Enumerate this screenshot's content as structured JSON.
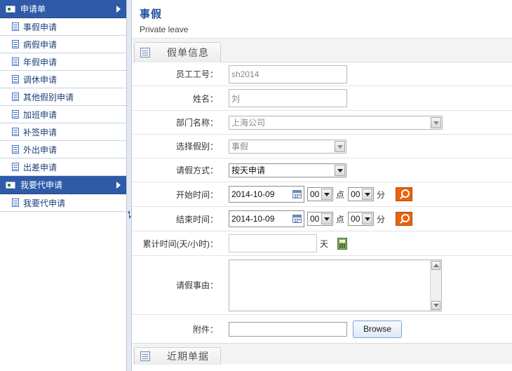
{
  "sidebar": {
    "groups": [
      {
        "title": "申请单",
        "items": [
          "事假申请",
          "病假申请",
          "年假申请",
          "调休申请",
          "其他假别申请",
          "加班申请",
          "补签申请",
          "外出申请",
          "出差申请"
        ]
      },
      {
        "title": "我要代申请",
        "items": [
          "我要代申请"
        ]
      }
    ]
  },
  "header": {
    "title": "事假",
    "subtitle": "Private leave"
  },
  "section1": {
    "label": "假单信息"
  },
  "section2": {
    "label": "近期单据"
  },
  "form": {
    "employee_id": {
      "label": "员工工号：",
      "value": "sh2014"
    },
    "name": {
      "label": "姓名：",
      "value": "刘"
    },
    "department": {
      "label": "部门名称：",
      "value": "上海公司"
    },
    "leave_type": {
      "label": "选择假别：",
      "value": "事假"
    },
    "leave_method": {
      "label": "请假方式：",
      "value": "按天申请"
    },
    "start": {
      "label": "开始时间：",
      "date": "2014-10-09",
      "hour": "00",
      "hour_unit": "点",
      "minute": "00",
      "minute_unit": "分"
    },
    "end": {
      "label": "结束时间：",
      "date": "2014-10-09",
      "hour": "00",
      "hour_unit": "点",
      "minute": "00",
      "minute_unit": "分"
    },
    "duration": {
      "label": "累计时间(天/小时)：",
      "value": "",
      "unit": "天"
    },
    "reason": {
      "label": "请假事由：",
      "value": ""
    },
    "attachment": {
      "label": "附件：",
      "button": "Browse"
    }
  },
  "colors": {
    "sidebar_header": "#2e5aa8",
    "title": "#1d4f9c",
    "search_button": "#e8630e"
  },
  "icons": [
    "group-icon",
    "document-icon",
    "calendar-icon",
    "search-icon",
    "calculator-icon",
    "form-icon"
  ]
}
